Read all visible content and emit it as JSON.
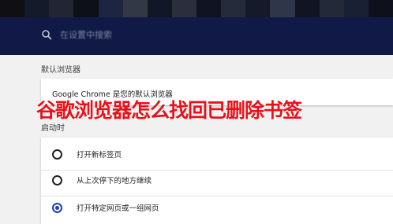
{
  "search": {
    "placeholder": "在设置中搜索",
    "icon": "search-icon"
  },
  "default_browser": {
    "section_title": "默认浏览器",
    "status_text": "Google Chrome 是您的默认浏览器"
  },
  "startup": {
    "section_title": "启动时",
    "options": [
      {
        "label": "打开新标签页",
        "checked": false
      },
      {
        "label": "从上次停下的地方继续",
        "checked": false
      },
      {
        "label": "打开特定网页或一组网页",
        "checked": true
      }
    ]
  },
  "overlay": {
    "title": "谷歌浏览器怎么找回已删除书签"
  },
  "colors": {
    "header_bg": "#111a46",
    "panel_bg": "#f1f1f1",
    "accent": "#1a3fb4",
    "overlay_red": "#e8111a"
  }
}
